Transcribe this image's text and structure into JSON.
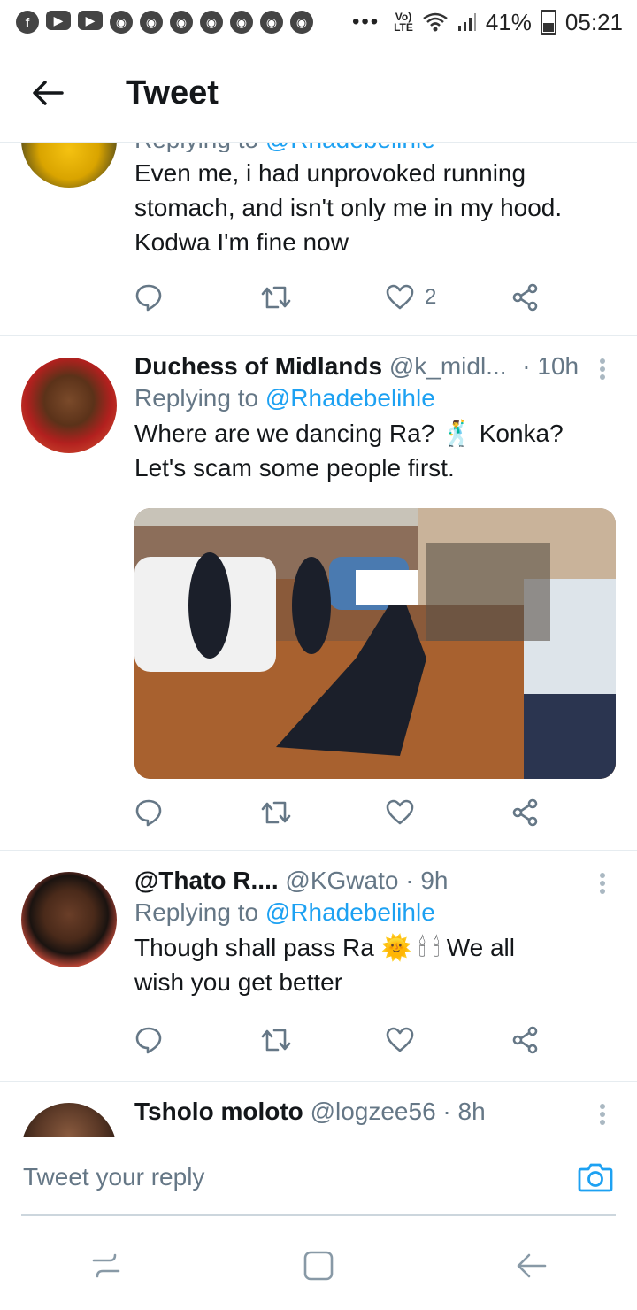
{
  "status_bar": {
    "app_icons": [
      "facebook-icon",
      "youtube-icon",
      "youtube-icon",
      "chrome-icon",
      "chrome-icon",
      "chrome-icon",
      "chrome-icon",
      "chrome-icon",
      "chrome-icon",
      "chrome-icon"
    ],
    "overflow": "•••",
    "network_top": "Vo)",
    "network_bottom": "LTE",
    "battery": "41%",
    "time": "05:21"
  },
  "header": {
    "title": "Tweet"
  },
  "tweets": [
    {
      "reply_prefix": "Replying to",
      "reply_handle": "@Rhadebelihle",
      "text_lines": [
        "Even me, i had unprovoked running",
        "stomach, and isn't only me in my hood.",
        "Kodwa I'm fine now"
      ],
      "like_count": "2"
    },
    {
      "name": "Duchess of Midlands",
      "handle": "@k_midl...",
      "time": "· 10h",
      "reply_prefix": "Replying to",
      "reply_handle": "@Rhadebelihle",
      "text_lines": [
        "Where are we dancing Ra? 🕺 Konka?",
        "Let's scam some people first."
      ],
      "like_count": ""
    },
    {
      "name": "@Thato R....",
      "handle": "@KGwato",
      "time": "· 9h",
      "reply_prefix": "Replying to",
      "reply_handle": "@Rhadebelihle",
      "text_lines": [
        "Though shall pass Ra 🌞 🕯 🕯  We all",
        "wish you get better"
      ],
      "like_count": ""
    },
    {
      "name": "Tsholo moloto",
      "handle": "@logzee56",
      "time": "· 8h"
    }
  ],
  "composer": {
    "placeholder": "Tweet your reply"
  },
  "colors": {
    "accent": "#1da1f2",
    "muted": "#657786",
    "text": "#14171a",
    "divider": "#e6ecf0"
  }
}
